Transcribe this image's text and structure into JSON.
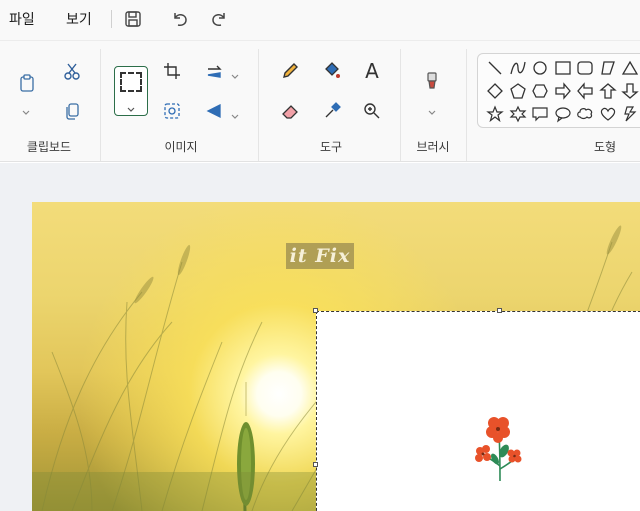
{
  "menu": {
    "file": "파일",
    "view": "보기"
  },
  "quick_access": {
    "icons": [
      "save-icon",
      "undo-icon",
      "redo-icon"
    ]
  },
  "ribbon": {
    "groups": [
      {
        "label": "클립보드",
        "tools": [
          "paste-icon",
          "cut-icon",
          "copy-icon"
        ]
      },
      {
        "label": "이미지",
        "tools": [
          "select-icon",
          "crop-icon",
          "resize-icon",
          "rotate-icon",
          "image-search-icon",
          "flip-icon"
        ]
      },
      {
        "label": "도구",
        "tools": [
          "pencil-icon",
          "fill-icon",
          "text-icon",
          "eraser-icon",
          "color-picker-icon",
          "magnifier-icon"
        ]
      },
      {
        "label": "브러시",
        "tools": [
          "brush-icon"
        ]
      },
      {
        "label": "도형",
        "tools": [
          "line",
          "curve",
          "oval",
          "rectangle",
          "rounded-rectangle",
          "polygon",
          "diamond",
          "pentagon",
          "hexagon",
          "right-arrow",
          "left-arrow",
          "up-arrow",
          "down-arrow",
          "four-point-star",
          "five-point-star",
          "six-point-star",
          "callout-rectangle",
          "callout-oval",
          "callout-cloud",
          "heart",
          "lightning"
        ]
      }
    ],
    "text_tool_glyph": "A"
  },
  "canvas": {
    "watermark": "it Fix",
    "colors": {
      "selection_border": "#333333",
      "select_tool_border": "#2c6e49",
      "flower_petal": "#e8522a",
      "flower_leaf": "#2e8b57"
    }
  }
}
